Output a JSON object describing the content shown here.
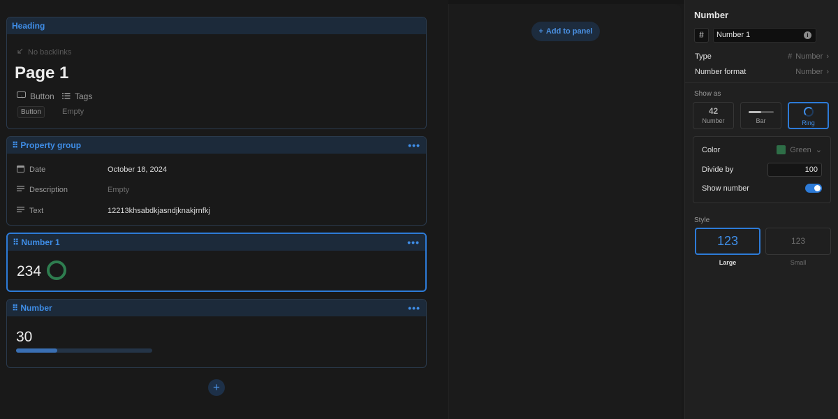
{
  "canvas": {
    "heading_card": {
      "header": "Heading",
      "backlinks": "No backlinks",
      "page_title": "Page 1",
      "props": [
        {
          "icon": "button-icon",
          "label": "Button",
          "value": "Button"
        },
        {
          "icon": "tags-icon",
          "label": "Tags",
          "value": "Empty"
        }
      ]
    },
    "property_group": {
      "header": "Property group",
      "rows": [
        {
          "icon": "calendar-icon",
          "label": "Date",
          "value": "October 18, 2024",
          "empty": false
        },
        {
          "icon": "lines-icon",
          "label": "Description",
          "value": "Empty",
          "empty": true
        },
        {
          "icon": "lines-icon",
          "label": "Text",
          "value": "12213khsabdkjasndjknakjrnfkj",
          "empty": false
        }
      ]
    },
    "number1_card": {
      "header": "Number 1",
      "value": "234",
      "ring_color": "#2e7d4f"
    },
    "number_card": {
      "header": "Number",
      "value": "30",
      "progress": 0.3
    },
    "add_card_label": "+"
  },
  "middle": {
    "add_panel": "Add to panel"
  },
  "side_panel": {
    "title": "Number",
    "name_value": "Number 1",
    "type_label": "Type",
    "type_value": "Number",
    "format_label": "Number format",
    "format_value": "Number",
    "show_as_label": "Show as",
    "show_as_options": [
      {
        "glyph": "42",
        "label": "Number",
        "active": false
      },
      {
        "glyph": "",
        "label": "Bar",
        "active": false
      },
      {
        "glyph": "",
        "label": "Ring",
        "active": true
      }
    ],
    "color_label": "Color",
    "color_value": "Green",
    "color_hex": "#2e6e47",
    "divide_label": "Divide by",
    "divide_value": "100",
    "show_number_label": "Show number",
    "show_number_on": true,
    "style_label": "Style",
    "style_options": [
      {
        "sample": "123",
        "label": "Large",
        "active": true
      },
      {
        "sample": "123",
        "label": "Small",
        "active": false
      }
    ]
  },
  "colors": {
    "accent": "#2d7bd8",
    "header_bg": "#1c2a3a",
    "ring_green": "#2e7d4f"
  }
}
